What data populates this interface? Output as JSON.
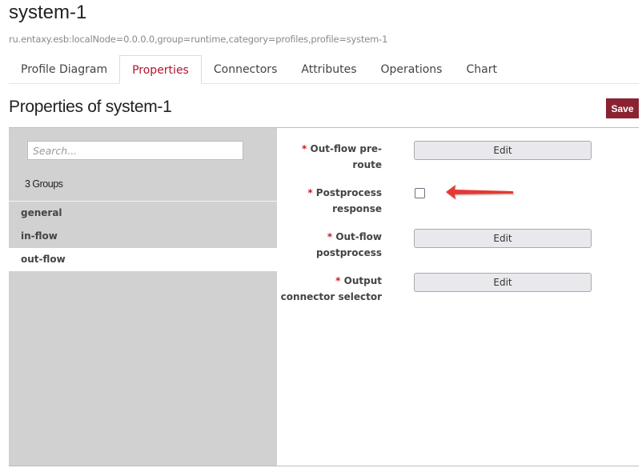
{
  "header": {
    "title": "system-1",
    "mbean": "ru.entaxy.esb:localNode=0.0.0.0,group=runtime,category=profiles,profile=system-1"
  },
  "tabs": [
    {
      "label": "Profile Diagram",
      "active": false
    },
    {
      "label": "Properties",
      "active": true
    },
    {
      "label": "Connectors",
      "active": false
    },
    {
      "label": "Attributes",
      "active": false
    },
    {
      "label": "Operations",
      "active": false
    },
    {
      "label": "Chart",
      "active": false
    }
  ],
  "page": {
    "title": "Properties of system-1",
    "save_label": "Save",
    "accent_color": "#8b2232"
  },
  "sidebar": {
    "search_placeholder": "Search...",
    "search_value": "",
    "groups_count": "3 Groups",
    "groups": [
      {
        "label": "general",
        "active": false
      },
      {
        "label": "in-flow",
        "active": false
      },
      {
        "label": "out-flow",
        "active": true
      }
    ]
  },
  "form": {
    "required_mark": "*",
    "fields": [
      {
        "label_line1": "Out-flow pre-",
        "label_line2": "route",
        "type": "button",
        "button_label": "Edit"
      },
      {
        "label_line1": "Postprocess",
        "label_line2": "response",
        "type": "checkbox",
        "checked": false
      },
      {
        "label_line1": "Out-flow",
        "label_line2": "postprocess",
        "type": "button",
        "button_label": "Edit"
      },
      {
        "label_line1": "Output",
        "label_line2": "connector selector",
        "type": "button",
        "button_label": "Edit"
      }
    ]
  },
  "annotation": {
    "icon": "red-arrow-left-icon",
    "color": "#e53935"
  }
}
